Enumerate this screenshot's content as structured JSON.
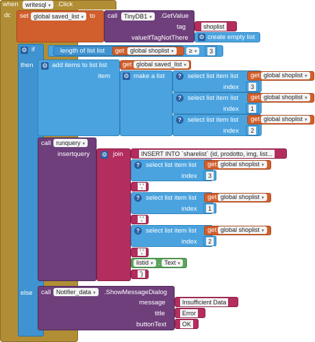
{
  "event": {
    "when": "when",
    "component": "writesql",
    "event": ".Click",
    "do": "do"
  },
  "set_block": {
    "set": "set",
    "var": "global saved_list",
    "to": "to"
  },
  "getvalue": {
    "call": "call",
    "component": "TinyDB1",
    "method": ".GetValue",
    "tag": "tag",
    "tag_value": "shoplist",
    "fallback_label": "valueIfTagNotThere",
    "create_empty": "create empty list"
  },
  "if_block": {
    "if": "if",
    "then": "then",
    "else": "else"
  },
  "condition": {
    "length_label": "length of list  list",
    "get": "get",
    "var": "global shoplist",
    "op": "≥",
    "value": "3"
  },
  "add_items": {
    "label": "add items to list  list",
    "get": "get",
    "var": "global saved_list",
    "item": "item",
    "make_list": "make a list"
  },
  "list_items": [
    {
      "label": "select list item  list",
      "get": "get",
      "var": "global shoplist",
      "index_label": "index",
      "index": "3"
    },
    {
      "label": "select list item  list",
      "get": "get",
      "var": "global shoplist",
      "index_label": "index",
      "index": "1"
    },
    {
      "label": "select list item  list",
      "get": "get",
      "var": "global shoplist",
      "index_label": "index",
      "index": "2"
    }
  ],
  "runquery": {
    "call": "call",
    "procedure": "runquery",
    "param": "insertquery",
    "join": "join",
    "sql": "INSERT INTO `sharelist` (id, prodotto, img, list...",
    "sep1": "','",
    "sep2": "','",
    "sep3": "','",
    "tail": "')",
    "listid": "listid",
    "text_prop": "Text"
  },
  "join_items": [
    {
      "label": "select list item  list",
      "get": "get",
      "var": "global shoplist",
      "index_label": "index",
      "index": "3"
    },
    {
      "label": "select list item  list",
      "get": "get",
      "var": "global shoplist",
      "index_label": "index",
      "index": "1"
    },
    {
      "label": "select list item  list",
      "get": "get",
      "var": "global shoplist",
      "index_label": "index",
      "index": "2"
    }
  ],
  "notifier": {
    "call": "call",
    "component": "Notifier_data",
    "method": ".ShowMessageDialog",
    "message_label": "message",
    "message": "Insufficient Data",
    "title_label": "title",
    "title": "Error",
    "button_label": "buttonText",
    "button": "OK"
  }
}
